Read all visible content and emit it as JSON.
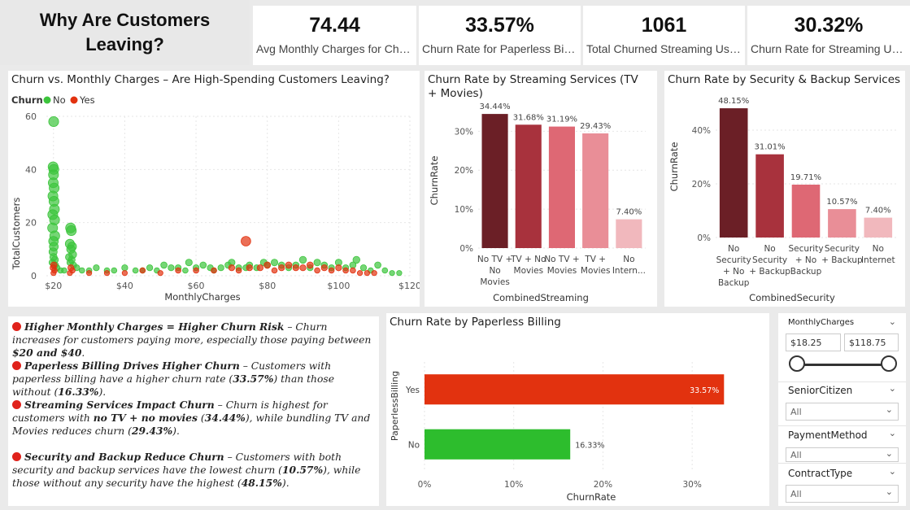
{
  "title": "Why Are Customers Leaving?",
  "kpis": [
    {
      "value": "74.44",
      "label": "Avg Monthly Charges for Churned Customers"
    },
    {
      "value": "33.57%",
      "label": "Churn Rate for Paperless Billing"
    },
    {
      "value": "1061",
      "label": "Total Churned Streaming Users"
    },
    {
      "value": "30.32%",
      "label": "Churn Rate for Streaming Users"
    }
  ],
  "scatter": {
    "title": "Churn vs. Monthly Charges – Are High-Spending Customers Leaving?",
    "legend_label": "Churn",
    "legend_no": "No",
    "legend_yes": "Yes",
    "xlabel": "MonthlyCharges",
    "ylabel": "TotalCustomers",
    "xticks": [
      "$20",
      "$40",
      "$60",
      "$80",
      "$100",
      "$120"
    ],
    "yticks": [
      "0",
      "20",
      "40",
      "60"
    ],
    "colors": {
      "no": "#3cc43c",
      "yes": "#e2320f"
    }
  },
  "streaming": {
    "title": "Churn Rate by Streaming Services (TV + Movies)",
    "xlabel": "CombinedStreaming",
    "ylabel": "ChurnRate",
    "yticks": [
      "0%",
      "10%",
      "20%",
      "30%"
    ],
    "bars": [
      {
        "label": "No TV + No Movies",
        "value_label": "34.44%",
        "color": "#6b1f26"
      },
      {
        "label": "TV + No Movies",
        "value_label": "31.68%",
        "color": "#a8323d"
      },
      {
        "label": "No TV + Movies",
        "value_label": "31.19%",
        "color": "#de6874"
      },
      {
        "label": "TV + Movies",
        "value_label": "29.43%",
        "color": "#e98e97"
      },
      {
        "label": "No Intern...",
        "value_label": "7.40%",
        "color": "#f1b8bd"
      }
    ]
  },
  "security": {
    "title": "Churn Rate by Security & Backup Services",
    "xlabel": "CombinedSecurity",
    "ylabel": "ChurnRate",
    "yticks": [
      "0%",
      "20%",
      "40%"
    ],
    "bars": [
      {
        "label": "No Security + No Backup",
        "value_label": "48.15%",
        "color": "#6b1f26"
      },
      {
        "label": "No Security + Backup",
        "value_label": "31.01%",
        "color": "#a8323d"
      },
      {
        "label": "Security + No Backup",
        "value_label": "19.71%",
        "color": "#de6874"
      },
      {
        "label": "Security + Backup",
        "value_label": "10.57%",
        "color": "#e98e97"
      },
      {
        "label": "No Internet",
        "value_label": "7.40%",
        "color": "#f1b8bd"
      }
    ]
  },
  "paperless": {
    "title": "Churn Rate by Paperless Billing",
    "xlabel": "ChurnRate",
    "ylabel": "PaperlessBilling",
    "xticks": [
      "0%",
      "10%",
      "20%",
      "30%"
    ],
    "bars": [
      {
        "label": "Yes",
        "value_label": "33.57%",
        "color": "#e2320f"
      },
      {
        "label": "No",
        "value_label": "16.33%",
        "color": "#2dbd2d"
      }
    ]
  },
  "insights": [
    {
      "head": "Higher Monthly Charges = Higher Churn Risk",
      "body": "– Churn increases for customers paying more, especially those paying between ",
      "b1": "$20 and $40",
      "tail": "."
    },
    {
      "head": "Paperless Billing Drives Higher Churn",
      "body": "– Customers with paperless billing have a higher churn rate (",
      "b1": "33.57%",
      "mid": ") than those without (",
      "b2": "16.33%",
      "tail": ")."
    },
    {
      "head": "Streaming Services Impact Churn",
      "body": "– Churn is highest for customers with ",
      "b1": "no TV + no movies",
      "mid": " (",
      "b2": "34.44%",
      "mid2": "), while bundling TV and Movies reduces churn (",
      "b3": "29.43%",
      "tail": ")."
    },
    {
      "head": "Security and Backup Reduce Churn",
      "body": "– Customers with both security and backup services have the lowest churn (",
      "b1": "10.57%",
      "mid": "), while those without any security have the highest (",
      "b2": "48.15%",
      "tail": ")."
    }
  ],
  "slicers": {
    "monthly_label": "MonthlyCharges",
    "monthly_min": "$18.25",
    "monthly_max": "$118.75",
    "senior_label": "SeniorCitizen",
    "senior_value": "All",
    "payment_label": "PaymentMethod",
    "payment_value": "All",
    "contract_label": "ContractType",
    "contract_value": "All"
  },
  "chart_data": [
    {
      "type": "scatter",
      "title": "Churn vs. Monthly Charges – Are High-Spending Customers Leaving?",
      "xlabel": "MonthlyCharges",
      "ylabel": "TotalCustomers",
      "xlim": [
        18,
        120
      ],
      "ylim": [
        0,
        60
      ],
      "series": [
        {
          "name": "No",
          "points": [
            [
              20.05,
              58
            ],
            [
              19.9,
              41
            ],
            [
              20.1,
              40
            ],
            [
              20.0,
              38
            ],
            [
              19.95,
              35
            ],
            [
              20.2,
              33
            ],
            [
              19.85,
              30
            ],
            [
              20.15,
              28
            ],
            [
              20.25,
              25
            ],
            [
              19.8,
              23
            ],
            [
              20.3,
              21
            ],
            [
              19.75,
              18
            ],
            [
              20.35,
              15
            ],
            [
              20.0,
              13
            ],
            [
              20.1,
              11
            ],
            [
              19.9,
              9
            ],
            [
              20.0,
              7
            ],
            [
              20.4,
              6
            ],
            [
              19.7,
              5
            ],
            [
              20.5,
              4
            ],
            [
              24.8,
              18
            ],
            [
              25.0,
              17
            ],
            [
              24.6,
              12
            ],
            [
              25.2,
              11
            ],
            [
              24.9,
              10
            ],
            [
              25.4,
              8
            ],
            [
              24.4,
              7
            ],
            [
              25.1,
              6
            ],
            [
              24.7,
              5
            ],
            [
              25.6,
              4
            ],
            [
              21.0,
              3
            ],
            [
              22.0,
              2
            ],
            [
              23.0,
              2
            ],
            [
              26.5,
              3
            ],
            [
              28,
              2
            ],
            [
              30,
              2
            ],
            [
              32,
              3
            ],
            [
              35,
              2
            ],
            [
              37,
              2
            ],
            [
              40,
              3
            ],
            [
              43,
              2
            ],
            [
              45,
              2
            ],
            [
              47,
              3
            ],
            [
              49,
              2
            ],
            [
              51,
              4
            ],
            [
              53,
              3
            ],
            [
              55,
              3
            ],
            [
              57,
              2
            ],
            [
              58,
              5
            ],
            [
              60,
              3
            ],
            [
              62,
              4
            ],
            [
              64,
              3
            ],
            [
              65,
              2
            ],
            [
              67,
              3
            ],
            [
              69,
              4
            ],
            [
              70,
              5
            ],
            [
              72,
              3
            ],
            [
              74,
              3
            ],
            [
              75,
              4
            ],
            [
              77,
              3
            ],
            [
              79,
              5
            ],
            [
              80,
              4
            ],
            [
              82,
              5
            ],
            [
              84,
              4
            ],
            [
              86,
              3
            ],
            [
              88,
              4
            ],
            [
              90,
              6
            ],
            [
              92,
              3
            ],
            [
              94,
              5
            ],
            [
              96,
              4
            ],
            [
              98,
              3
            ],
            [
              100,
              5
            ],
            [
              102,
              3
            ],
            [
              104,
              4
            ],
            [
              105,
              6
            ],
            [
              107,
              3
            ],
            [
              109,
              2
            ],
            [
              111,
              4
            ],
            [
              113,
              2
            ],
            [
              115,
              1
            ],
            [
              117,
              1
            ]
          ]
        },
        {
          "name": "Yes",
          "points": [
            [
              20.1,
              4
            ],
            [
              19.9,
              3
            ],
            [
              20.3,
              2
            ],
            [
              20.0,
              1
            ],
            [
              24.9,
              3
            ],
            [
              25.3,
              2
            ],
            [
              24.6,
              1
            ],
            [
              30,
              1
            ],
            [
              35,
              1
            ],
            [
              40,
              1
            ],
            [
              45,
              2
            ],
            [
              50,
              1
            ],
            [
              55,
              2
            ],
            [
              60,
              2
            ],
            [
              65,
              2
            ],
            [
              70,
              3
            ],
            [
              72,
              2
            ],
            [
              74,
              13
            ],
            [
              75,
              3
            ],
            [
              78,
              3
            ],
            [
              80,
              4
            ],
            [
              82,
              2
            ],
            [
              84,
              3
            ],
            [
              86,
              4
            ],
            [
              88,
              3
            ],
            [
              90,
              3
            ],
            [
              92,
              4
            ],
            [
              94,
              2
            ],
            [
              96,
              3
            ],
            [
              98,
              2
            ],
            [
              100,
              3
            ],
            [
              102,
              2
            ],
            [
              104,
              2
            ],
            [
              106,
              1
            ],
            [
              108,
              1
            ],
            [
              110,
              1
            ]
          ]
        }
      ]
    },
    {
      "type": "bar",
      "title": "Churn Rate by Streaming Services (TV + Movies)",
      "xlabel": "CombinedStreaming",
      "ylabel": "ChurnRate",
      "categories": [
        "No TV + No Movies",
        "TV + No Movies",
        "No TV + Movies",
        "TV + Movies",
        "No Intern..."
      ],
      "values": [
        34.44,
        31.68,
        31.19,
        29.43,
        7.4
      ],
      "ylim": [
        0,
        38
      ]
    },
    {
      "type": "bar",
      "title": "Churn Rate by Security & Backup Services",
      "xlabel": "CombinedSecurity",
      "ylabel": "ChurnRate",
      "categories": [
        "No Security + No Backup",
        "No Security + Backup",
        "Security + No Backup",
        "Security + Backup",
        "No Internet"
      ],
      "values": [
        48.15,
        31.01,
        19.71,
        10.57,
        7.4
      ],
      "ylim": [
        0,
        50
      ]
    },
    {
      "type": "bar",
      "title": "Churn Rate by Paperless Billing",
      "xlabel": "ChurnRate",
      "ylabel": "PaperlessBilling",
      "categories": [
        "Yes",
        "No"
      ],
      "values": [
        33.57,
        16.33
      ],
      "xlim": [
        0,
        35
      ]
    }
  ]
}
